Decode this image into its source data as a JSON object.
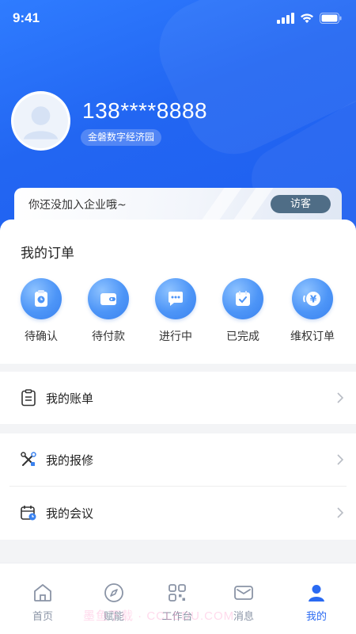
{
  "status_bar": {
    "time": "9:41"
  },
  "profile": {
    "phone": "138****8888",
    "park_name": "金磐数字经济园"
  },
  "enterprise_notice": {
    "message": "你还没加入企业哦~",
    "visitor_button": "访客"
  },
  "orders": {
    "title": "我的订单",
    "items": [
      {
        "label": "待确认",
        "icon": "clipboard-clock-icon"
      },
      {
        "label": "待付款",
        "icon": "wallet-icon"
      },
      {
        "label": "进行中",
        "icon": "chat-bubble-icon"
      },
      {
        "label": "已完成",
        "icon": "calendar-check-icon"
      },
      {
        "label": "维权订单",
        "icon": "yuan-refund-icon"
      }
    ]
  },
  "menu": {
    "bill": "我的账单",
    "repair": "我的报修",
    "meeting": "我的会议"
  },
  "tabbar": {
    "items": [
      {
        "label": "首页",
        "icon": "home-icon"
      },
      {
        "label": "赋能",
        "icon": "compass-icon"
      },
      {
        "label": "工作台",
        "icon": "grid-icon"
      },
      {
        "label": "消息",
        "icon": "mail-icon"
      },
      {
        "label": "我的",
        "icon": "user-icon"
      }
    ],
    "active_index": 4
  },
  "colors": {
    "primary": "#2266f2",
    "visitor_button": "#4f6d86",
    "active_tab": "#2a6af2",
    "inactive_tab": "#8a94a6"
  },
  "watermark": "墨鱼下载 · CCLEDU.COM"
}
